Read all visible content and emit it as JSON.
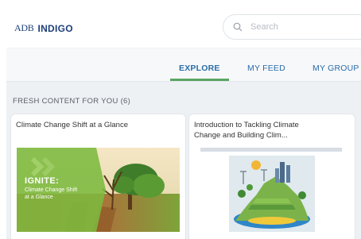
{
  "brand": {
    "logo_text": "ADB",
    "app_name": "INDIGO"
  },
  "search": {
    "placeholder": "Search"
  },
  "tabs": [
    {
      "label": "EXPLORE",
      "active": true
    },
    {
      "label": "MY FEED",
      "active": false
    },
    {
      "label": "MY GROUP",
      "active": false
    }
  ],
  "section": {
    "title": "FRESH CONTENT FOR YOU (6)"
  },
  "cards": [
    {
      "title": "Climate Change Shift at a Glance",
      "image": {
        "badge": "IGNITE:",
        "subtitle": "Climate Change Shift at a Glance"
      }
    },
    {
      "title_line1": "Introduction to Tackling Climate",
      "title_line2": "Change and Building Clim..."
    }
  ],
  "colors": {
    "brand_blue": "#1d3f7a",
    "tab_blue": "#2a6ea6",
    "active_underline": "#5aa564",
    "ignite_green": "#7cba3f"
  }
}
